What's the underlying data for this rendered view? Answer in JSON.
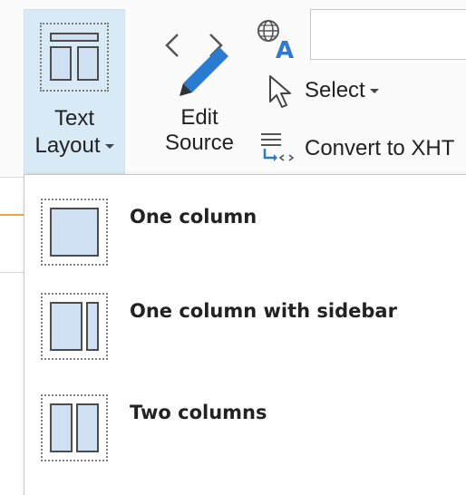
{
  "ribbon": {
    "text_layout": {
      "line1": "Text",
      "line2": "Layout",
      "icon": "text-layout-icon"
    },
    "edit_source": {
      "line1": "Edit",
      "line2": "Source",
      "icon": "edit-source-icon"
    },
    "spelling": {
      "icon": "spelling-language-icon"
    },
    "search": {
      "value": ""
    },
    "select": {
      "label": "Select",
      "icon": "cursor-select-icon"
    },
    "convert": {
      "label": "Convert to XHT",
      "icon": "convert-xhtml-icon"
    }
  },
  "dropdown": {
    "items": [
      {
        "label": "One column",
        "icon": "one-column-icon"
      },
      {
        "label": "One column with sidebar",
        "icon": "one-column-sidebar-icon"
      },
      {
        "label": "Two columns",
        "icon": "two-columns-icon"
      }
    ]
  },
  "colors": {
    "pressed_background": "#d9eaf7",
    "icon_fill": "#cfe0f3",
    "pencil_blue": "#2b7bd0",
    "accent_orange": "#f0a640"
  }
}
